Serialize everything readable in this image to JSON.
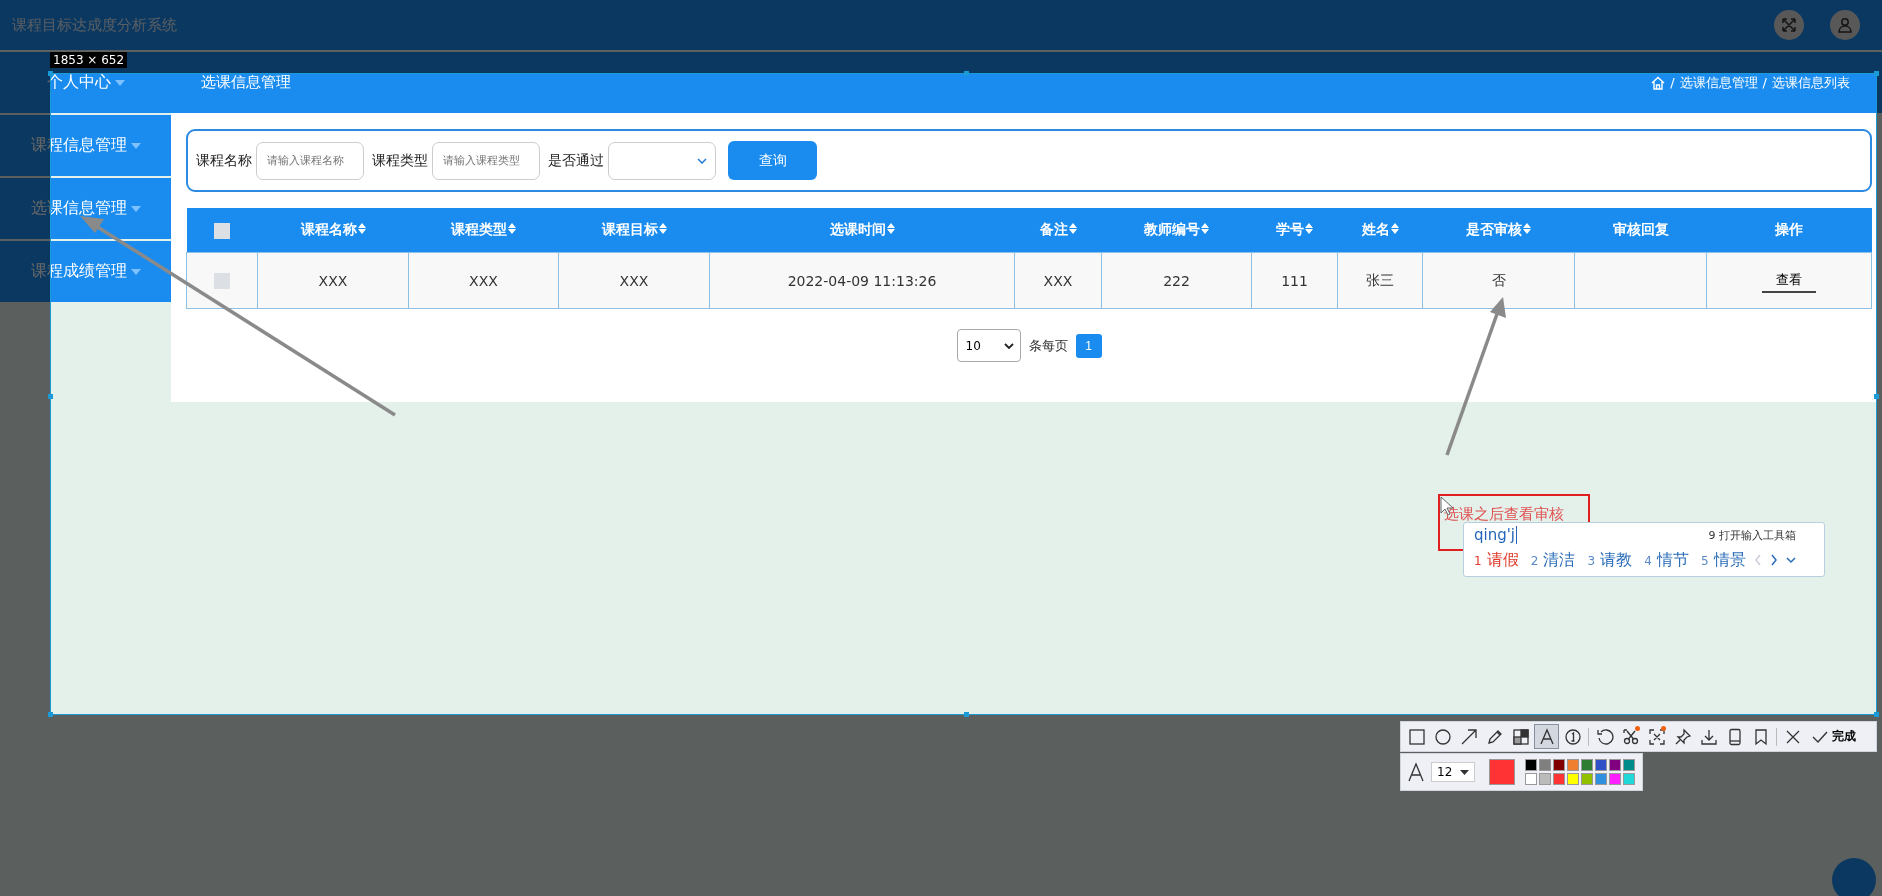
{
  "app": {
    "title": "课程目标达成度分析系统"
  },
  "sidebar": {
    "items": [
      {
        "label": "个人中心"
      },
      {
        "label": "课程信息管理"
      },
      {
        "label": "选课信息管理"
      },
      {
        "label": "课程成绩管理"
      }
    ]
  },
  "page_header": {
    "title": "选课信息管理",
    "separator": "/",
    "breadcrumb": [
      "选课信息管理",
      "选课信息列表"
    ]
  },
  "search": {
    "fields": [
      {
        "label": "课程名称",
        "placeholder": "请输入课程名称"
      },
      {
        "label": "课程类型",
        "placeholder": "请输入课程类型"
      }
    ],
    "select_label": "是否通过",
    "button": "查询"
  },
  "table": {
    "header_checked": false,
    "columns": [
      {
        "label": "课程名称",
        "sortable": true
      },
      {
        "label": "课程类型",
        "sortable": true
      },
      {
        "label": "课程目标",
        "sortable": true
      },
      {
        "label": "选课时间",
        "sortable": true
      },
      {
        "label": "备注",
        "sortable": true
      },
      {
        "label": "教师编号",
        "sortable": true
      },
      {
        "label": "学号",
        "sortable": true
      },
      {
        "label": "姓名",
        "sortable": true
      },
      {
        "label": "是否审核",
        "sortable": true
      },
      {
        "label": "审核回复",
        "sortable": false
      },
      {
        "label": "操作",
        "sortable": false
      }
    ],
    "rows": [
      {
        "checked": false,
        "cells": [
          "XXX",
          "XXX",
          "XXX",
          "2022-04-09 11:13:26",
          "XXX",
          "222",
          "111",
          "张三",
          "否",
          null
        ],
        "action": "查看"
      }
    ]
  },
  "pagination": {
    "page_size": "10",
    "per_page_label": "条每页",
    "pages": [
      {
        "label": "1",
        "selected": true
      }
    ]
  },
  "capture": {
    "size_label": "1853 × 652"
  },
  "annotation": {
    "text": "选课之后查看审核"
  },
  "ime": {
    "input": "qing'j",
    "toolbox": "9 打开输入工具箱",
    "candidates": [
      {
        "index": "1",
        "text": "请假",
        "selected": true
      },
      {
        "index": "2",
        "text": "清洁",
        "selected": false
      },
      {
        "index": "3",
        "text": "请教",
        "selected": false
      },
      {
        "index": "4",
        "text": "情节",
        "selected": false
      },
      {
        "index": "5",
        "text": "情景",
        "selected": false
      }
    ]
  },
  "toolbar": {
    "tools": [
      {
        "kind": "rectangle",
        "selected": false,
        "badge": false
      },
      {
        "kind": "ellipse",
        "selected": false,
        "badge": false
      },
      {
        "kind": "arrow",
        "selected": false,
        "badge": false
      },
      {
        "kind": "pencil",
        "selected": false,
        "badge": false
      },
      {
        "kind": "mosaic",
        "selected": false,
        "badge": false
      },
      {
        "kind": "text",
        "selected": true,
        "badge": false
      },
      {
        "kind": "number",
        "selected": false,
        "badge": false
      },
      {
        "kind": "separator"
      },
      {
        "kind": "undo",
        "selected": false,
        "badge": false
      },
      {
        "kind": "scissors",
        "selected": false,
        "badge": true
      },
      {
        "kind": "scan",
        "selected": false,
        "badge": true
      },
      {
        "kind": "pin",
        "selected": false,
        "badge": false
      },
      {
        "kind": "download",
        "selected": false,
        "badge": false
      },
      {
        "kind": "phone",
        "selected": false,
        "badge": false
      },
      {
        "kind": "bookmark",
        "selected": false,
        "badge": false
      },
      {
        "kind": "separator"
      },
      {
        "kind": "close",
        "selected": false,
        "badge": false
      }
    ],
    "done_label": "完成",
    "font_size": "12",
    "palette": [
      {
        "color": "#000000"
      },
      {
        "color": "#7f7f7f"
      },
      {
        "color": "#800000"
      },
      {
        "color": "#f08030"
      },
      {
        "color": "#2e7d32"
      },
      {
        "color": "#3050c8"
      },
      {
        "color": "#800080"
      },
      {
        "color": "#008b8b"
      },
      {
        "color": "#ffffff"
      },
      {
        "color": "#bbbbbb"
      },
      {
        "color": "#ff3333"
      },
      {
        "color": "#ffff00"
      },
      {
        "color": "#90c000"
      },
      {
        "color": "#3090e0"
      },
      {
        "color": "#ff20ff"
      },
      {
        "color": "#20d8d8"
      }
    ]
  }
}
